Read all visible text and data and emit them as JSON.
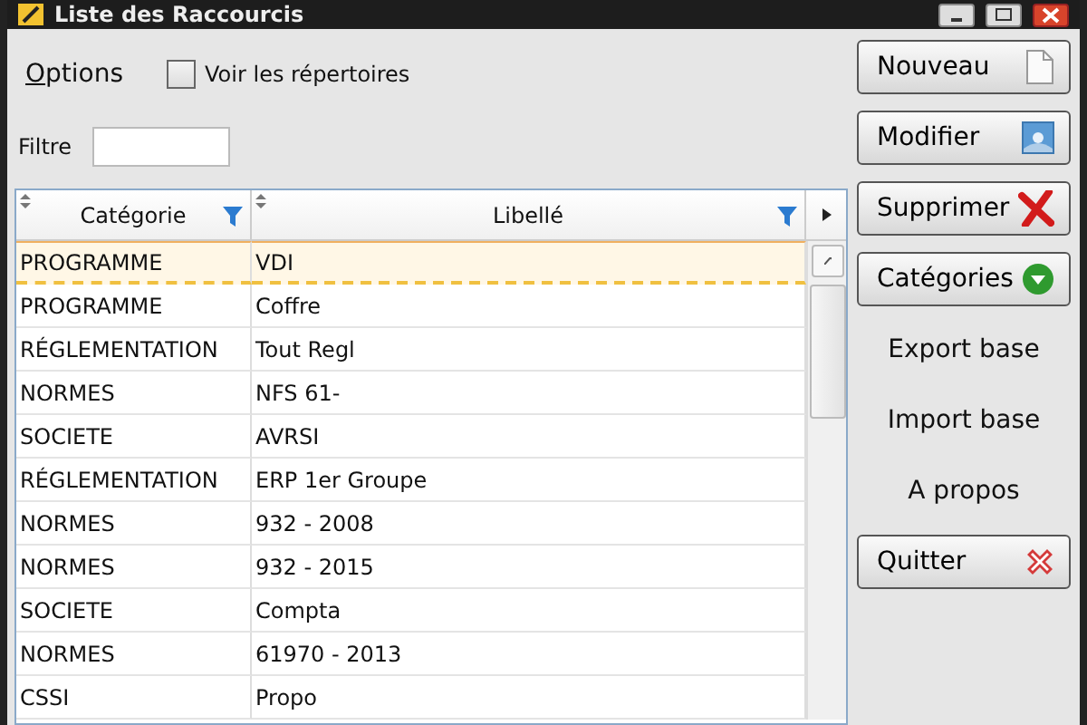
{
  "window": {
    "title": "Liste des Raccourcis"
  },
  "menu": {
    "label": "Options"
  },
  "show_folders": {
    "label": "Voir les répertoires",
    "checked": false
  },
  "filter": {
    "label": "Filtre"
  },
  "table": {
    "columns": [
      "Catégorie",
      "Libellé"
    ],
    "rows": [
      {
        "category": "PROGRAMME",
        "label": "VDI",
        "selected": true
      },
      {
        "category": "PROGRAMME",
        "label": "Coffre",
        "selected": false
      },
      {
        "category": "RÉGLEMENTATION",
        "label": "Tout Regl",
        "selected": false
      },
      {
        "category": "NORMES",
        "label": "NFS 61-",
        "selected": false
      },
      {
        "category": "SOCIETE",
        "label": "AVRSI",
        "selected": false
      },
      {
        "category": "RÉGLEMENTATION",
        "label": "ERP 1er Groupe",
        "selected": false
      },
      {
        "category": "NORMES",
        "label": "932 - 2008",
        "selected": false
      },
      {
        "category": "NORMES",
        "label": "932 - 2015",
        "selected": false
      },
      {
        "category": "SOCIETE",
        "label": "Compta",
        "selected": false
      },
      {
        "category": "NORMES",
        "label": "61970 - 2013",
        "selected": false
      },
      {
        "category": "CSSI",
        "label": "Propo",
        "selected": false
      }
    ]
  },
  "actions": [
    {
      "label": "Nouveau",
      "kind": "button"
    },
    {
      "label": "Modifier",
      "kind": "button"
    },
    {
      "label": "Supprimer",
      "kind": "button"
    },
    {
      "label": "Catégories",
      "kind": "button"
    },
    {
      "label": "Export base",
      "kind": "link"
    },
    {
      "label": "Import base",
      "kind": "link"
    },
    {
      "label": "A propos",
      "kind": "link"
    },
    {
      "label": "Quitter",
      "kind": "button"
    }
  ]
}
